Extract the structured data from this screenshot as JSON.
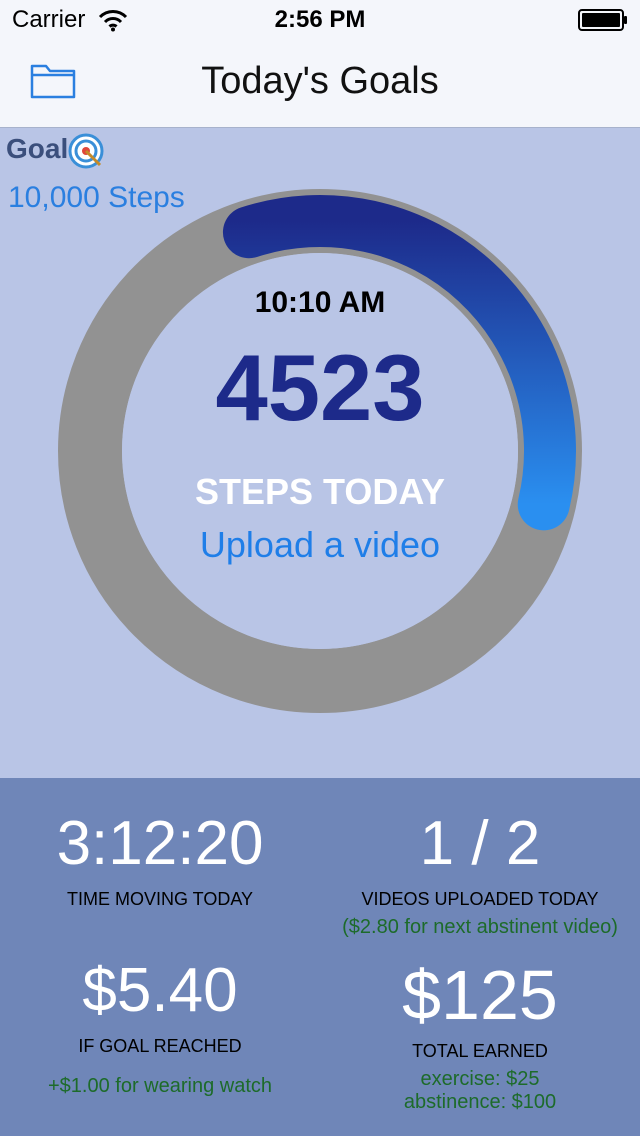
{
  "status_bar": {
    "carrier": "Carrier",
    "time": "2:56 PM"
  },
  "nav": {
    "title": "Today's Goals",
    "left_icon": "folder-icon"
  },
  "goal": {
    "label": "Goal",
    "icon": "target-icon",
    "value": "10,000 Steps"
  },
  "ring": {
    "time": "10:10 AM",
    "steps": "4523",
    "caption": "STEPS TODAY",
    "link": "Upload a video",
    "progress": 0.4523,
    "colors": {
      "track": "#929292",
      "progress_start": "#1d2a8a",
      "progress_end": "#2a8ff0"
    }
  },
  "stats": {
    "time_moving": {
      "value": "3:12:20",
      "label": "TIME MOVING TODAY"
    },
    "videos": {
      "value": "1 / 2",
      "label": "VIDEOS UPLOADED TODAY",
      "note": "($2.80 for next abstinent video)"
    },
    "goal_reward": {
      "value": "$5.40",
      "label": "IF GOAL REACHED",
      "note": "+$1.00 for wearing watch"
    },
    "total": {
      "value": "$125",
      "label": "TOTAL EARNED",
      "exercise": "exercise: $25",
      "abstinence": "abstinence: $100"
    }
  }
}
